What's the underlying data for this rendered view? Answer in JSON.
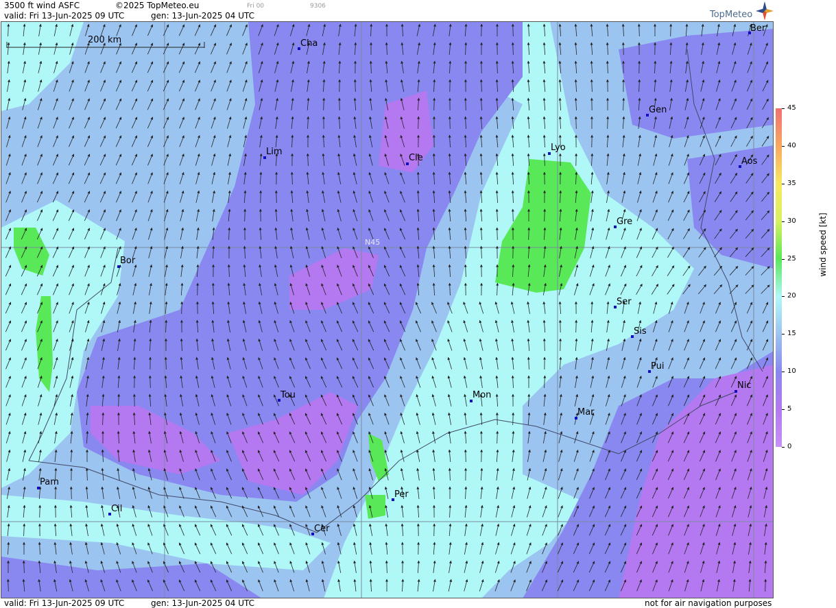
{
  "header": {
    "title": "3500 ft wind ASFC",
    "copyright": "©2025 TopMeteo.eu",
    "valid": "valid:  Fri  13-Jun-2025  09 UTC",
    "gen": "gen: 13-Jun-2025 04 UTC",
    "run": "Fri 00",
    "code": "9306",
    "brand": "TopMeteo"
  },
  "map": {
    "scale_label": "200 km",
    "grid_label": "N45",
    "cities": [
      {
        "name": "Cha"
      },
      {
        "name": "Ber"
      },
      {
        "name": "Gen"
      },
      {
        "name": "Lim"
      },
      {
        "name": "Cle"
      },
      {
        "name": "Lyo"
      },
      {
        "name": "Aos"
      },
      {
        "name": "Gre"
      },
      {
        "name": "Bor"
      },
      {
        "name": "Ser"
      },
      {
        "name": "Sis"
      },
      {
        "name": "Pui"
      },
      {
        "name": "Tou"
      },
      {
        "name": "Mon"
      },
      {
        "name": "Nic"
      },
      {
        "name": "Mar"
      },
      {
        "name": "Pam"
      },
      {
        "name": "Per"
      },
      {
        "name": "Cil"
      },
      {
        "name": "Cer"
      }
    ]
  },
  "legend": {
    "title": "wind  speed  [kt]",
    "ticks": [
      "45",
      "40",
      "35",
      "30",
      "25",
      "20",
      "15",
      "10",
      "5",
      "0"
    ],
    "colors": [
      "#f07070",
      "#f8a860",
      "#f8e860",
      "#d8f060",
      "#58e858",
      "#b0f8f8",
      "#9cc4f0",
      "#8888f0",
      "#b478f0",
      "#c890f8"
    ]
  },
  "footer": {
    "valid": "valid:  Fri  13-Jun-2025  09 UTC",
    "gen": "gen: 13-Jun-2025 04 UTC",
    "disclaimer": "not for air navigation purposes"
  }
}
